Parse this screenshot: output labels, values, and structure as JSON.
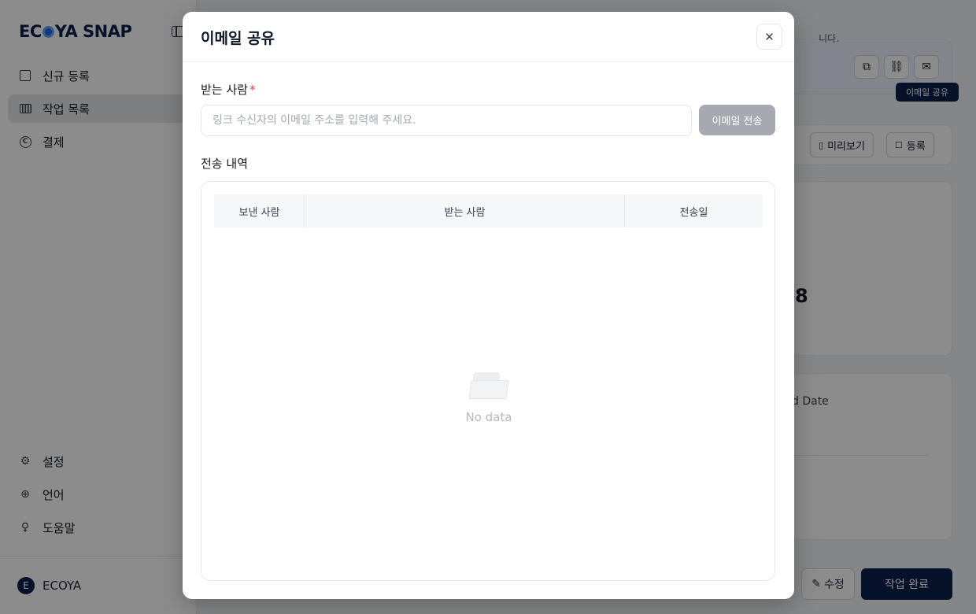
{
  "app": {
    "logo_text_a": "EC",
    "logo_text_b": "YA SNAP",
    "nav_top": [
      {
        "label": "신규 등록",
        "icon": "edit-square-icon"
      },
      {
        "label": "작업 목록",
        "icon": "list-icon"
      },
      {
        "label": "결제",
        "icon": "copyright-icon"
      }
    ],
    "nav_bottom": [
      {
        "label": "설정",
        "icon": "gear-icon"
      },
      {
        "label": "언어",
        "icon": "globe-icon"
      },
      {
        "label": "도움말",
        "icon": "lightbulb-icon"
      }
    ],
    "user": {
      "initial": "E",
      "name": "ECOYA"
    },
    "card1_text": "니다.",
    "tooltip": "이메일 공유",
    "preview_btn": "미리보기",
    "register_btn": "등록",
    "big_number": "8",
    "card4_label": "d Date",
    "edit_btn": "수정",
    "done_btn": "작업 완료",
    "colors": {
      "navy": "#0b1f4d",
      "accent": "#2563eb"
    }
  },
  "modal": {
    "title": "이메일 공유",
    "close_icon": "close-icon",
    "recipient_label": "받는 사람",
    "required_mark": "*",
    "email_placeholder": "링크 수신자의 이메일 주소를 입력해 주세요.",
    "email_value": "",
    "send_button": "이메일 전송",
    "history_label": "전송 내역",
    "table": {
      "headers": [
        "보낸 사람",
        "받는 사람",
        "전송일"
      ],
      "rows": []
    },
    "empty_text": "No data"
  }
}
